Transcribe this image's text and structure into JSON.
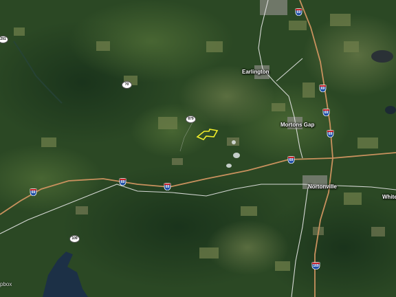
{
  "map": {
    "style": "satellite",
    "colors": {
      "forest": "#2c4a24",
      "interstate": "#c9915e",
      "highway": "#e9e9e9",
      "parcel": "#f2ee2a",
      "water": "#1d3245",
      "shield": "#1f4fa6"
    },
    "places": [
      {
        "name": "Earlington"
      },
      {
        "name": "Mortons Gap"
      },
      {
        "name": "Nortonville"
      },
      {
        "name": "White"
      }
    ],
    "interstate_shields": [
      "69",
      "69",
      "69",
      "69",
      "69",
      "69",
      "69",
      "69",
      "169"
    ],
    "route_markers": [
      "291",
      "70",
      "879",
      "109"
    ],
    "attribution": "pbox"
  }
}
